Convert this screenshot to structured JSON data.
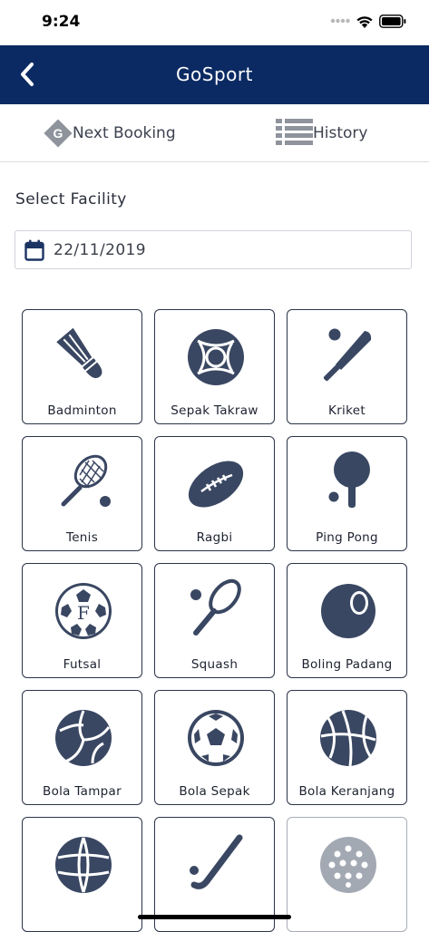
{
  "status": {
    "time": "9:24"
  },
  "header": {
    "title": "GoSport"
  },
  "tabs": {
    "next_booking": "Next Booking",
    "history": "History"
  },
  "form": {
    "section_title": "Select Facility",
    "date_value": "22/11/2019"
  },
  "facilities": [
    {
      "label": "Badminton",
      "icon": "shuttlecock-icon"
    },
    {
      "label": "Sepak Takraw",
      "icon": "takraw-ball-icon"
    },
    {
      "label": "Kriket",
      "icon": "cricket-bat-icon"
    },
    {
      "label": "Tenis",
      "icon": "tennis-racket-icon"
    },
    {
      "label": "Ragbi",
      "icon": "rugby-ball-icon"
    },
    {
      "label": "Ping Pong",
      "icon": "ping-pong-paddle-icon"
    },
    {
      "label": "Futsal",
      "icon": "futsal-ball-icon"
    },
    {
      "label": "Squash",
      "icon": "squash-racket-icon"
    },
    {
      "label": "Boling Padang",
      "icon": "lawn-bowl-icon"
    },
    {
      "label": "Bola Tampar",
      "icon": "volleyball-icon"
    },
    {
      "label": "Bola Sepak",
      "icon": "soccer-ball-icon"
    },
    {
      "label": "Bola Keranjang",
      "icon": "basketball-icon"
    },
    {
      "label": "",
      "icon": "netball-icon"
    },
    {
      "label": "",
      "icon": "hockey-stick-icon"
    },
    {
      "label": "",
      "icon": "pickleball-icon"
    }
  ],
  "colors": {
    "header_bg": "#0b2a63",
    "icon": "#3a4762",
    "icon_disabled": "#a3a9b3"
  }
}
